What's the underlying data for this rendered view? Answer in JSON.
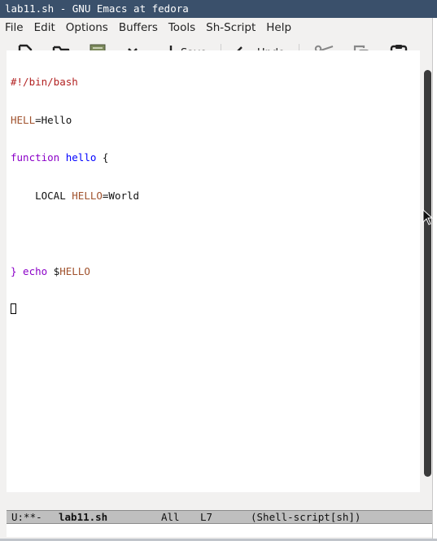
{
  "window": {
    "title": "lab11.sh - GNU Emacs at fedora"
  },
  "menubar": {
    "items": [
      "File",
      "Edit",
      "Options",
      "Buffers",
      "Tools",
      "Sh-Script",
      "Help"
    ]
  },
  "toolbar": {
    "new_icon": "new-file-icon",
    "open_icon": "open-folder-icon",
    "dired_icon": "dired-icon",
    "close_icon": "close-icon",
    "save_label": "Save",
    "undo_label": "Undo",
    "cut_icon": "scissors-icon",
    "copy_icon": "copy-icon",
    "paste_icon": "paste-icon"
  },
  "buffer": {
    "lines": [
      {
        "segments": [
          {
            "text": "#!/bin/bash",
            "style": "comment"
          }
        ]
      },
      {
        "segments": [
          {
            "text": "HELL",
            "style": "var"
          },
          {
            "text": "=Hello",
            "style": "plain"
          }
        ]
      },
      {
        "segments": [
          {
            "text": "function",
            "style": "kw"
          },
          {
            "text": " ",
            "style": "plain"
          },
          {
            "text": "hello",
            "style": "fn"
          },
          {
            "text": " {",
            "style": "plain"
          }
        ]
      },
      {
        "segments": [
          {
            "text": "    LOCAL ",
            "style": "plain"
          },
          {
            "text": "HELLO",
            "style": "var"
          },
          {
            "text": "=World",
            "style": "plain"
          }
        ]
      },
      {
        "segments": [
          {
            "text": "",
            "style": "plain"
          }
        ]
      },
      {
        "segments": [
          {
            "text": "} echo ",
            "style": "kw"
          },
          {
            "text": "$",
            "style": "plain"
          },
          {
            "text": "HELLO",
            "style": "var"
          }
        ]
      }
    ]
  },
  "modeline": {
    "status": "U:**-",
    "buffer_name": "lab11.sh",
    "position": "All",
    "line": "L7",
    "mode": "(Shell-script[sh])"
  },
  "colors": {
    "titlebar": "#3a506b",
    "comment": "#b22222",
    "variable": "#a0522d",
    "keyword": "#8b00c8",
    "function_name": "#0000ff",
    "modeline": "#bfbfbf"
  }
}
